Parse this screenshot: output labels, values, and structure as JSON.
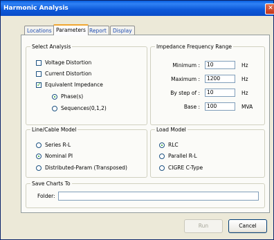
{
  "window": {
    "title": "Harmonic Analysis",
    "close_glyph": "✕"
  },
  "tabs": [
    {
      "label": "Locations"
    },
    {
      "label": "Parameters"
    },
    {
      "label": "Report"
    },
    {
      "label": "Display"
    }
  ],
  "select_analysis": {
    "title": "Select Analysis",
    "voltage_distortion": {
      "label": "Voltage Distortion",
      "checked": false
    },
    "current_distortion": {
      "label": "Current Distortion",
      "checked": false
    },
    "equivalent_impedance": {
      "label": "Equivalent Impedance",
      "checked": true
    },
    "phases": {
      "label": "Phase(s)",
      "selected": true
    },
    "sequences": {
      "label": "Sequences(0,1,2)",
      "selected": false
    }
  },
  "impedance_range": {
    "title": "Impedance Frequency Range",
    "minimum": {
      "label": "Minimum :",
      "value": "10",
      "unit": "Hz"
    },
    "maximum": {
      "label": "Maximum :",
      "value": "1200",
      "unit": "Hz"
    },
    "step": {
      "label": "By step of :",
      "value": "10",
      "unit": "Hz"
    },
    "base": {
      "label": "Base :",
      "value": "100",
      "unit": "MVA"
    }
  },
  "line_cable_model": {
    "title": "Line/Cable Model",
    "options": [
      {
        "label": "Series R-L",
        "selected": false
      },
      {
        "label": "Nominal PI",
        "selected": true
      },
      {
        "label": "Distributed-Param (Transposed)",
        "selected": false
      }
    ]
  },
  "load_model": {
    "title": "Load Model",
    "options": [
      {
        "label": "RLC",
        "selected": true
      },
      {
        "label": "Parallel R-L",
        "selected": false
      },
      {
        "label": "CIGRE C-Type",
        "selected": false
      }
    ]
  },
  "save_charts": {
    "title": "Save Charts To",
    "folder_label": "Folder:",
    "folder_value": ""
  },
  "buttons": {
    "run": "Run",
    "cancel": "Cancel"
  },
  "colors": {
    "title_bar": "#0A5FE0",
    "dialog_bg": "#ECE9D8",
    "active_tab_accent": "#F1A62F",
    "check_mark": "#21A121"
  }
}
